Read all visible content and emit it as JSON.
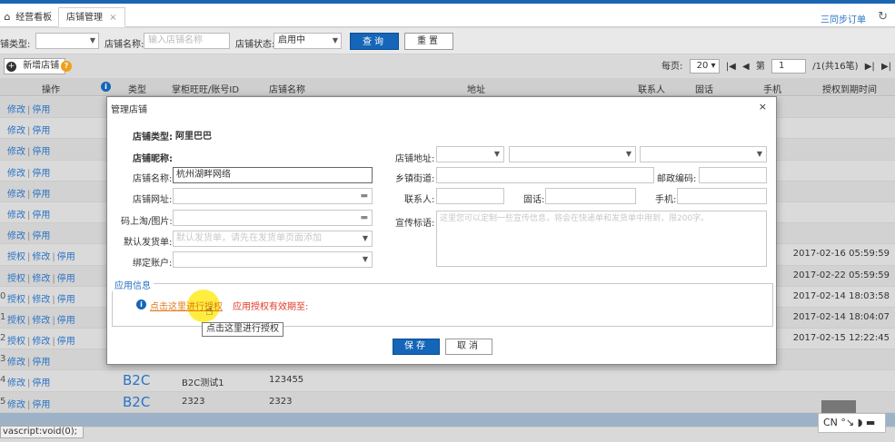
{
  "tabs": {
    "home_label": "经营看板",
    "store_label": "店铺管理",
    "close_glyph": "×",
    "sync_label": "三同步订单"
  },
  "filter": {
    "type_label": "铺类型:",
    "type_value": "",
    "name_label": "店铺名称:",
    "name_placeholder": "输入店铺名称",
    "status_label": "店铺状态:",
    "status_value": "启用中",
    "query_btn": "查询",
    "reset_btn": "重置"
  },
  "toolbar": {
    "add_btn": "新增店铺",
    "help_glyph": "?",
    "per_page_label": "每页:",
    "per_page_value": "20",
    "first_glyph": "|◀",
    "prev_glyph": "◀",
    "page_prefix": "第",
    "page_value": "1",
    "page_suffix": "/1(共16笔)",
    "next_glyph": "▶|",
    "last_glyph": "▶|"
  },
  "table": {
    "headers": {
      "op": "操作",
      "type": "类型",
      "account": "掌柜旺旺/账号ID",
      "shop": "店铺名称",
      "address": "地址",
      "contact": "联系人",
      "phone": "固话",
      "mobile": "手机",
      "auth_time": "授权到期时间"
    },
    "rows": [
      {
        "idx": "",
        "ops": [
          "修改",
          "停用"
        ],
        "auth_time": "",
        "type": "",
        "name": "",
        "shop": ""
      },
      {
        "idx": "",
        "ops": [
          "修改",
          "停用"
        ],
        "auth_time": "",
        "type": "",
        "name": "",
        "shop": ""
      },
      {
        "idx": "",
        "ops": [
          "修改",
          "停用"
        ],
        "auth_time": "",
        "type": "",
        "name": "",
        "shop": ""
      },
      {
        "idx": "",
        "ops": [
          "修改",
          "停用"
        ],
        "auth_time": "",
        "type": "",
        "name": "",
        "shop": ""
      },
      {
        "idx": "",
        "ops": [
          "修改",
          "停用"
        ],
        "auth_time": "",
        "type": "",
        "name": "",
        "shop": ""
      },
      {
        "idx": "",
        "ops": [
          "修改",
          "停用"
        ],
        "auth_time": "",
        "type": "",
        "name": "",
        "shop": ""
      },
      {
        "idx": "",
        "ops": [
          "修改",
          "停用"
        ],
        "auth_time": "",
        "type": "",
        "name": "",
        "shop": ""
      },
      {
        "idx": "",
        "ops": [
          "授权",
          "修改",
          "停用"
        ],
        "auth_time": "2017-02-16 05:59:59",
        "type": "",
        "name": "",
        "shop": ""
      },
      {
        "idx": "",
        "ops": [
          "授权",
          "修改",
          "停用"
        ],
        "auth_time": "2017-02-22 05:59:59",
        "type": "",
        "name": "",
        "shop": ""
      },
      {
        "idx": "0",
        "ops": [
          "授权",
          "修改",
          "停用"
        ],
        "auth_time": "2017-02-14 18:03:58",
        "type": "",
        "name": "",
        "shop": ""
      },
      {
        "idx": "1",
        "ops": [
          "授权",
          "修改",
          "停用"
        ],
        "auth_time": "2017-02-14 18:04:07",
        "type": "",
        "name": "",
        "shop": ""
      },
      {
        "idx": "2",
        "ops": [
          "授权",
          "修改",
          "停用"
        ],
        "auth_time": "2017-02-15 12:22:45",
        "type": "",
        "name": "",
        "shop": ""
      },
      {
        "idx": "3",
        "ops": [
          "修改",
          "停用"
        ],
        "auth_time": "",
        "type": "",
        "name": "",
        "shop": ""
      },
      {
        "idx": "4",
        "ops": [
          "修改",
          "停用"
        ],
        "auth_time": "",
        "type": "B2C",
        "name": "B2C测试1",
        "shop": "123455"
      },
      {
        "idx": "5",
        "ops": [
          "修改",
          "停用"
        ],
        "auth_time": "",
        "type": "B2C",
        "name": "2323",
        "shop": "2323"
      }
    ]
  },
  "statusbar": {
    "text": "vascript:void(0);"
  },
  "ime": {
    "text": "CN °↘ ◗ ▬"
  },
  "modal": {
    "title": "管理店铺",
    "close_glyph": "×",
    "store_type_label": "店铺类型:",
    "store_type_value": "阿里巴巴",
    "store_nick_label": "店铺昵称:",
    "store_name_label": "店铺名称:",
    "store_name_value": "杭州湖畔网络",
    "store_url_label": "店铺网址:",
    "img_label": "码上淘/图片:",
    "default_ship_label": "默认发货单:",
    "default_ship_placeholder": "默认发货单，请先在发货单页面添加",
    "bind_account_label": "绑定账户:",
    "dots_glyph": "▬",
    "address_label": "店铺地址:",
    "street_label": "乡镇街道:",
    "zip_label": "邮政编码:",
    "contact_label": "联系人:",
    "phone_label": "固话:",
    "mobile_label": "手机:",
    "slogan_label": "宣传标语:",
    "slogan_placeholder": "这里您可以定制一些宣传信息，将会在快递单和发货单中用到，限200字。",
    "app_info_legend": "应用信息",
    "auth_link": "点击这里进行授权",
    "auth_valid": "应用授权有效期至:",
    "tooltip": "点击这里进行授权",
    "save_btn": "保存",
    "cancel_btn": "取消"
  }
}
